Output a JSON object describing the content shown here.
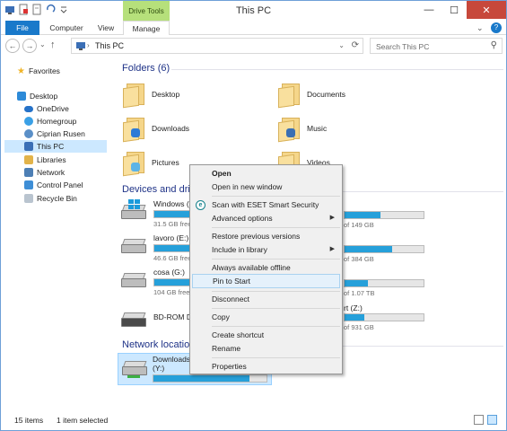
{
  "window": {
    "title": "This PC",
    "context_tab_group": "Drive Tools",
    "close_glyph": "✕",
    "min_glyph": "—",
    "max_glyph": "☐"
  },
  "ribbon": {
    "tabs": [
      "File",
      "Computer",
      "View",
      "Manage"
    ],
    "chevron": "⌄",
    "help": "?"
  },
  "address": {
    "path": "This PC",
    "path_chevron": "›",
    "dropdown_glyph": "⌄",
    "refresh_glyph": "⟳",
    "back_glyph": "←",
    "forward_glyph": "→",
    "recent_glyph": "⌄",
    "up_glyph": "↑"
  },
  "search": {
    "placeholder": "Search This PC",
    "icon_glyph": "⚲"
  },
  "nav": {
    "favorites": "Favorites",
    "desktop": "Desktop",
    "items": [
      "OneDrive",
      "Homegroup",
      "Ciprian Rusen",
      "This PC",
      "Libraries",
      "Network",
      "Control Panel",
      "Recycle Bin"
    ]
  },
  "content": {
    "folders_header": "Folders (6)",
    "folders": [
      "Desktop",
      "Documents",
      "Downloads",
      "Music",
      "Pictures",
      "Videos"
    ],
    "devices_header": "Devices and drives",
    "drives": [
      {
        "name": "Windows (C:)",
        "free": "31.5 GB free",
        "fill": 0.82
      },
      {
        "name": "lavoro (E:)",
        "free": "46.6 GB free",
        "fill": 0.65
      },
      {
        "name": "cosa (G:)",
        "free": "104 GB free",
        "fill": 0.55
      },
      {
        "name": "BD-ROM Drive"
      }
    ],
    "right_drives": [
      {
        "text": "of 149 GB",
        "fill": 0.45
      },
      {
        "text": "of 384 GB",
        "fill": 0.6
      },
      {
        "text": "of 1.07 TB",
        "fill": 0.3
      },
      {
        "label": "rt (Z:)",
        "text": "of 931 GB",
        "fill": 0.25
      }
    ],
    "network_header": "Network locations",
    "network_drive": {
      "name": "Downloads",
      "sub": "(Y:)",
      "fill": 0.85
    }
  },
  "context_menu": {
    "items": [
      "Open",
      "Open in new window",
      "Scan with ESET Smart Security",
      "Advanced options",
      "Restore previous versions",
      "Include in library",
      "Always available offline",
      "Pin to Start",
      "Disconnect",
      "Copy",
      "Create shortcut",
      "Rename",
      "Properties"
    ],
    "eset_glyph": "e",
    "submenu_glyph": "▶"
  },
  "status": {
    "count": "15 items",
    "selected": "1 item selected"
  },
  "colors": {
    "accent": "#1979ca",
    "selected": "#cce8ff",
    "bar": "#26a0da",
    "header": "#1e3287",
    "context_tab": "#b6e07b"
  }
}
